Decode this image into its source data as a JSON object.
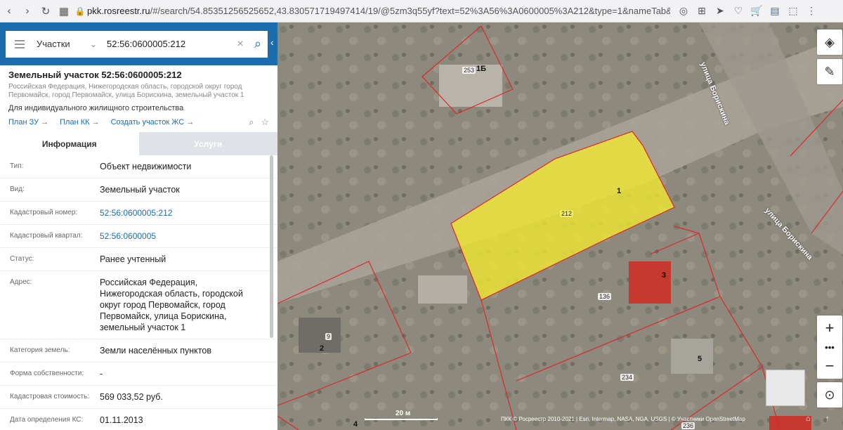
{
  "browser": {
    "url_host": "pkk.rosreestr.ru",
    "url_rest": "/#/search/54.85351256525652,43.830571719497414/19/@5zm3q55yf?text=52%3A56%3A0600005%3A212&type=1&nameTab&in"
  },
  "search": {
    "type_label": "Участки",
    "query": "52:56:0600005:212"
  },
  "card": {
    "title": "Земельный участок 52:56:0600005:212",
    "address": "Российская Федерация, Нижегородская область, городской округ город Первомайск, город Первомайск, улица Борискина, земельный участок 1",
    "use": "Для индивидуального жилищного строительства",
    "links": [
      "План ЗУ →",
      "План КК →",
      "Создать участок ЖС →"
    ]
  },
  "tabs": [
    "Информация",
    "Услуги"
  ],
  "info": [
    {
      "k": "Тип:",
      "v": "Объект недвижимости",
      "link": false
    },
    {
      "k": "Вид:",
      "v": "Земельный участок",
      "link": false
    },
    {
      "k": "Кадастровый номер:",
      "v": "52:56:0600005:212",
      "link": true
    },
    {
      "k": "Кадастровый квартал:",
      "v": "52:56:0600005",
      "link": true
    },
    {
      "k": "Статус:",
      "v": "Ранее учтенный",
      "link": false
    },
    {
      "k": "Адрес:",
      "v": "Российская Федерация, Нижегородская область, городской округ город Первомайск, город Первомайск, улица Борискина, земельный участок 1",
      "link": false
    },
    {
      "k": "Категория земель:",
      "v": "Земли населённых пунктов",
      "link": false
    },
    {
      "k": "Форма собственности:",
      "v": "-",
      "link": false
    },
    {
      "k": "Кадастровая стоимость:",
      "v": "569 033,52 руб.",
      "link": false
    },
    {
      "k": "Дата определения КС:",
      "v": "01.11.2013",
      "link": false
    }
  ],
  "map": {
    "selected_plot": "212",
    "plot_numbers": [
      "253",
      "136",
      "234",
      "9",
      "236"
    ],
    "house_numbers": [
      "1Б",
      "1",
      "3",
      "2",
      "5",
      "4"
    ],
    "street_name": "улица Борискина",
    "scale_label": "20 м",
    "attribution": "ПКК © Росреестр 2010-2021 | Esri, Intermap, NASA, NGA, USGS | © Участники OpenStreetMap",
    "highlight_color": "#f2ea2e",
    "boundary_color": "#e0262a"
  }
}
